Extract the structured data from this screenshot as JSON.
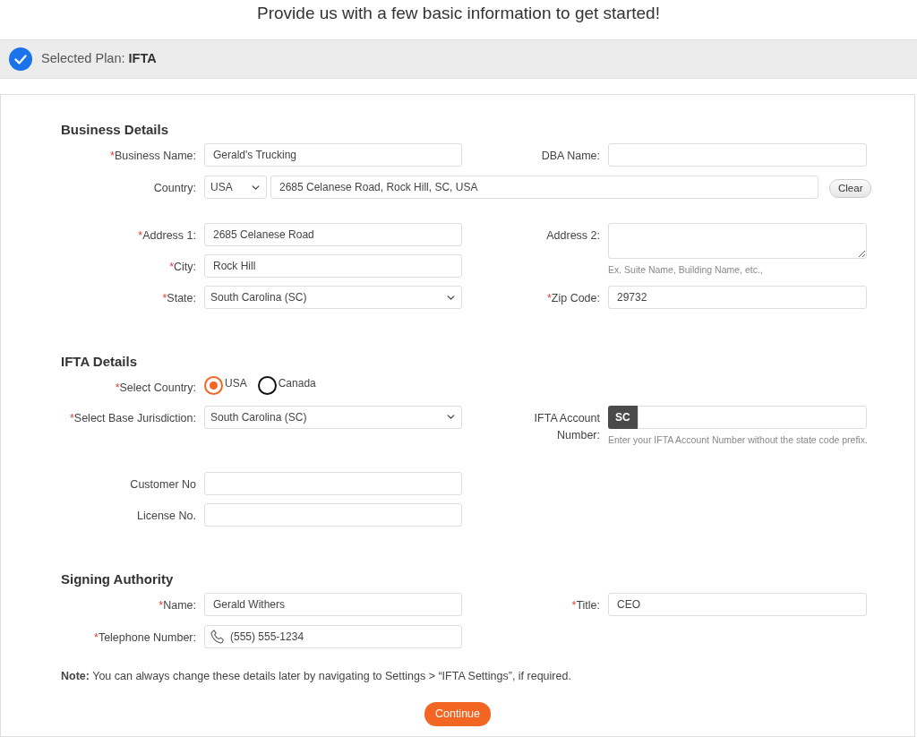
{
  "heading": "Provide us with a few basic information to get started!",
  "plan": {
    "label": "Selected Plan:",
    "name": "IFTA"
  },
  "sections": [
    {
      "title": "Business Details",
      "rows": [
        {
          "left": [
            {
              "kind": "text",
              "mark": "*",
              "label": "Business Name:",
              "value": "Gerald's Trucking"
            }
          ],
          "right": [
            {
              "kind": "text",
              "label": "DBA Name:"
            }
          ]
        },
        {
          "full": {
            "kind": "country_search",
            "label": "Country:",
            "country": "USA",
            "value": "2685 Celanese Road, Rock Hill, SC, USA",
            "button": "Clear"
          }
        },
        {
          "left": [
            {
              "kind": "text",
              "mark": "*",
              "label": "Address 1:",
              "value": "2685 Celanese Road"
            },
            {
              "kind": "text",
              "mark": "*",
              "label": "City:",
              "value": "Rock Hill"
            },
            {
              "kind": "select",
              "mark": "*",
              "label": "State:",
              "value": "South Carolina (SC)"
            }
          ],
          "right": [
            {
              "kind": "textarea",
              "label": "Address 2:",
              "hint": "Ex. Suite Name, Building Name, etc.,"
            },
            {
              "kind": "text",
              "mark": "*",
              "label": "Zip Code:",
              "value": "29732"
            }
          ]
        }
      ]
    },
    {
      "title": "IFTA Details",
      "rows": [
        {
          "left": [
            {
              "kind": "radio",
              "mark": "*",
              "label": "Select Country:",
              "options": [
                {
                  "label": "USA",
                  "selected": true
                },
                {
                  "label": "Canada",
                  "selected": false
                }
              ]
            }
          ]
        },
        {
          "left": [
            {
              "kind": "select",
              "mark": "*",
              "label": "Select Base Jurisdiction:",
              "value": "South Carolina (SC)"
            }
          ],
          "right": [
            {
              "kind": "prefixed",
              "label": "IFTA Account Number:",
              "prefix": "SC",
              "hint": "Enter your IFTA Account Number without the state code prefix."
            }
          ]
        },
        {
          "left": [
            {
              "kind": "text",
              "label": "Customer No"
            },
            {
              "kind": "text",
              "label": "License No."
            }
          ]
        }
      ]
    },
    {
      "title": "Signing Authority",
      "rows": [
        {
          "left": [
            {
              "kind": "text",
              "mark": "*",
              "label": "Name:",
              "value": "Gerald Withers"
            }
          ],
          "right": [
            {
              "kind": "text",
              "mark": "*",
              "label": "Title:",
              "value": "CEO"
            }
          ]
        },
        {
          "left": [
            {
              "kind": "phone",
              "mark": "*",
              "label": "Telephone Number:",
              "value": "(555) 555-1234"
            }
          ]
        }
      ]
    }
  ],
  "note": "**Note:** You can always change these details later by navigating to Settings > “IFTA Settings”, if required.",
  "continue_button": "Continue"
}
